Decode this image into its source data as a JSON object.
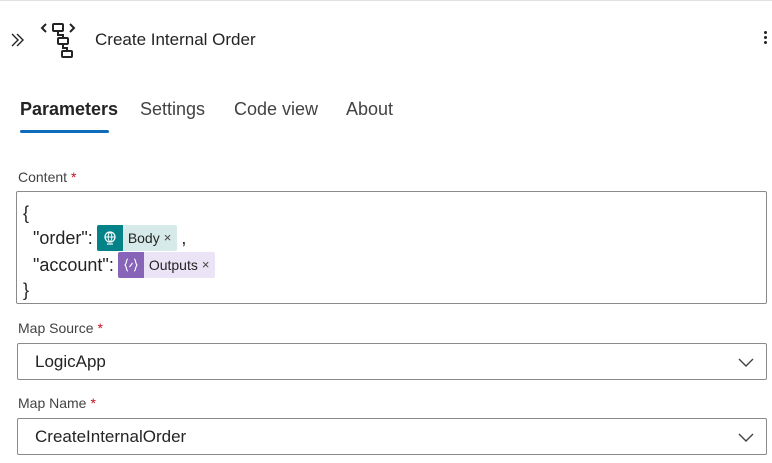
{
  "header": {
    "title": "Create Internal Order",
    "collapse_icon": "double-chevron-right-icon",
    "action_icon": "transform-map-icon",
    "more_icon": "more-vertical-icon"
  },
  "tabs": [
    {
      "label": "Parameters",
      "active": true
    },
    {
      "label": "Settings",
      "active": false
    },
    {
      "label": "Code view",
      "active": false
    },
    {
      "label": "About",
      "active": false
    }
  ],
  "content": {
    "label": "Content",
    "required_marker": "*",
    "open_brace": "{",
    "close_brace": "}",
    "lines": [
      {
        "key": "  \"order\":",
        "token_label": "Body",
        "token_remove": "×",
        "token_color": "#038387",
        "token_bg": "#d6ebe9",
        "token_icon": "globe-icon",
        "suffix": ","
      },
      {
        "key": "  \"account\":",
        "token_label": "Outputs",
        "token_remove": "×",
        "token_color": "#8764b8",
        "token_bg": "#ebe4f7",
        "token_icon": "curly-braces-icon",
        "suffix": ""
      }
    ]
  },
  "map_source": {
    "label": "Map Source",
    "required_marker": "*",
    "value": "LogicApp"
  },
  "map_name": {
    "label": "Map Name",
    "required_marker": "*",
    "value": "CreateInternalOrder"
  },
  "colors": {
    "accent": "#0f6cbd",
    "required": "#c50f1f"
  }
}
